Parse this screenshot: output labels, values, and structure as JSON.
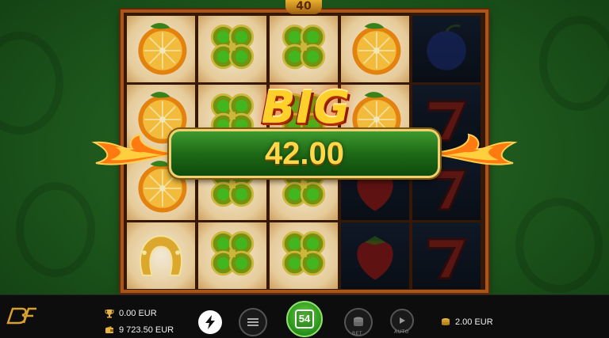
{
  "game": {
    "top_badge": "40",
    "reels": [
      [
        "orange-symbol",
        "orange-symbol",
        "orange-symbol",
        "golden-horseshoe-symbol"
      ],
      [
        "clover-symbol",
        "clover-symbol",
        "clover-symbol",
        "clover-symbol"
      ],
      [
        "clover-symbol",
        "clover-symbol",
        "clover-symbol",
        "clover-symbol"
      ],
      [
        "orange-symbol",
        "orange-symbol",
        "strawberry-symbol",
        "strawberry-symbol"
      ],
      [
        "plum-symbol",
        "seven-symbol",
        "seven-symbol",
        "seven-symbol"
      ]
    ]
  },
  "big_win": {
    "title": "BIG WIN",
    "amount": "42.00"
  },
  "toolbar": {
    "last_win": "0.00 EUR",
    "balance": "9 723.50 EUR",
    "spin_count": "54",
    "bet_label": "BET",
    "auto_label": "AUTO",
    "bet_value": "2.00 EUR"
  },
  "colors": {
    "spin_button": "#2f9a1e",
    "win_text": "#ffd84a",
    "reel_border": "#a8561c"
  }
}
